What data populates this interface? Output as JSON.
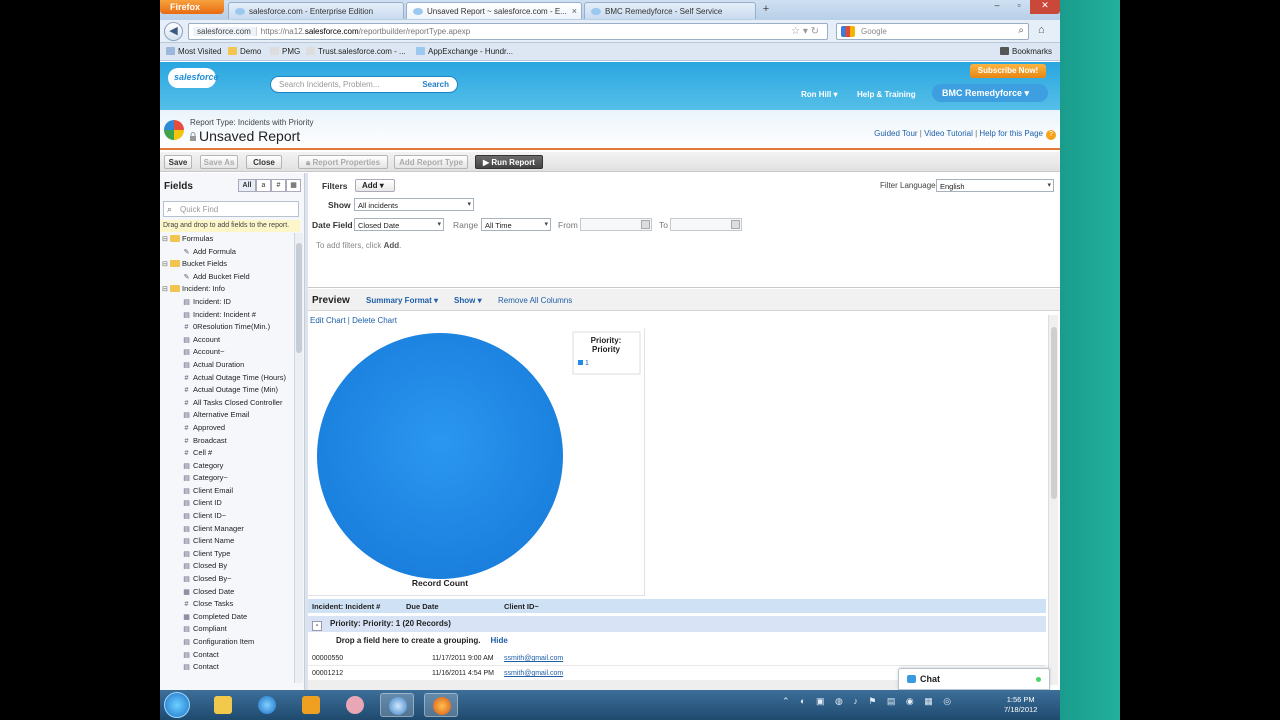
{
  "browser": {
    "menu_label": "Firefox",
    "tabs": [
      {
        "label": "salesforce.com - Enterprise Edition"
      },
      {
        "label": "Unsaved Report ~ salesforce.com - E..."
      },
      {
        "label": "BMC Remedyforce - Self Service"
      }
    ],
    "url_site": "salesforce.com",
    "url_prefix": "https://na12.",
    "url_host": "salesforce.com",
    "url_path": "/reportbuilder/reportType.apexp",
    "search_placeholder": "Google",
    "bookmarks": [
      "Most Visited",
      "Demo",
      "PMG",
      "Trust.salesforce.com - ...",
      "AppExchange - Hundr..."
    ],
    "bookmarks_menu": "Bookmarks"
  },
  "sf_header": {
    "logo": "salesforce",
    "search_placeholder": "Search Incidents, Problem...",
    "search_button": "Search",
    "subscribe_button": "Subscribe Now!",
    "user_menu": "Ron Hill",
    "help_menu": "Help & Training",
    "app_menu": "BMC Remedyforce"
  },
  "title_bar": {
    "report_type": "Report Type: Incidents with Priority",
    "title": "Unsaved Report",
    "help_links": [
      "Guided Tour",
      "Video Tutorial",
      "Help for this Page"
    ]
  },
  "toolbar": {
    "save": "Save",
    "save_as": "Save As",
    "close": "Close",
    "report_properties": "Report Properties",
    "add_report_type": "Add Report Type",
    "run_report": "Run Report"
  },
  "fields_panel": {
    "title": "Fields",
    "filter_all": "All",
    "quick_find_placeholder": "Quick Find",
    "drag_hint": "Drag and drop to add fields to the report.",
    "tree": [
      {
        "type": "folder",
        "label": "Formulas"
      },
      {
        "type": "add",
        "label": "Add Formula"
      },
      {
        "type": "folder",
        "label": "Bucket Fields"
      },
      {
        "type": "add",
        "label": "Add Bucket Field"
      },
      {
        "type": "folder",
        "label": "Incident: Info"
      },
      {
        "type": "text",
        "label": "Incident: ID"
      },
      {
        "type": "text",
        "label": "Incident: Incident #"
      },
      {
        "type": "num",
        "label": "0Resolution Time(Min.)"
      },
      {
        "type": "text",
        "label": "Account"
      },
      {
        "type": "text",
        "label": "Account~"
      },
      {
        "type": "text",
        "label": "Actual Duration"
      },
      {
        "type": "num",
        "label": "Actual Outage Time (Hours)"
      },
      {
        "type": "num",
        "label": "Actual Outage Time (Min)"
      },
      {
        "type": "num",
        "label": "All Tasks Closed Controller"
      },
      {
        "type": "text",
        "label": "Alternative Email"
      },
      {
        "type": "num",
        "label": "Approved"
      },
      {
        "type": "num",
        "label": "Broadcast"
      },
      {
        "type": "num",
        "label": "Cell #"
      },
      {
        "type": "text",
        "label": "Category"
      },
      {
        "type": "text",
        "label": "Category~"
      },
      {
        "type": "text",
        "label": "Client Email"
      },
      {
        "type": "text",
        "label": "Client ID"
      },
      {
        "type": "text",
        "label": "Client ID~"
      },
      {
        "type": "text",
        "label": "Client Manager"
      },
      {
        "type": "text",
        "label": "Client Name"
      },
      {
        "type": "text",
        "label": "Client Type"
      },
      {
        "type": "text",
        "label": "Closed By"
      },
      {
        "type": "text",
        "label": "Closed By~"
      },
      {
        "type": "date",
        "label": "Closed Date"
      },
      {
        "type": "num",
        "label": "Close Tasks"
      },
      {
        "type": "date",
        "label": "Completed Date"
      },
      {
        "type": "text",
        "label": "Compliant"
      },
      {
        "type": "text",
        "label": "Configuration Item"
      },
      {
        "type": "text",
        "label": "Contact"
      },
      {
        "type": "text",
        "label": "Contact"
      }
    ]
  },
  "filters": {
    "label": "Filters",
    "add_button": "Add",
    "show_label": "Show",
    "show_value": "All incidents",
    "date_field_label": "Date Field",
    "date_field_value": "Closed Date",
    "range_label": "Range",
    "range_value": "All Time",
    "from_label": "From",
    "to_label": "To",
    "hint_prefix": "To add filters, click ",
    "hint_action": "Add",
    "hint_suffix": ".",
    "filter_language_label": "Filter Language",
    "filter_language_value": "English"
  },
  "preview": {
    "title": "Preview",
    "format": "Summary Format",
    "show": "Show",
    "remove_all": "Remove All Columns",
    "edit_chart": "Edit Chart",
    "delete_chart": "Delete Chart",
    "columns": [
      "Incident: Incident #",
      "Due Date",
      "Client ID~"
    ],
    "group_label": "Priority: Priority: 1 (20 Records)",
    "group_toggle": "-",
    "drop_hint": "Drop a field here to create a grouping.",
    "hide_link": "Hide",
    "rows": [
      {
        "id": "00000550",
        "date": "11/17/2011 9:00 AM",
        "email": "ssmith@gmail.com"
      },
      {
        "id": "00001212",
        "date": "11/16/2011 4:54 PM",
        "email": "ssmith@gmail.com"
      }
    ]
  },
  "chart_data": {
    "type": "pie",
    "categories": [
      "1"
    ],
    "values": [
      20
    ],
    "title": "",
    "xlabel": "Record Count",
    "legend_title": "Priority: Priority",
    "legend_position": "top-right",
    "color": "#1f8be8"
  },
  "chat": {
    "label": "Chat"
  },
  "taskbar": {
    "time": "1:56 PM",
    "date": "7/18/2012"
  },
  "colors": {
    "sf_blue": "#2aa6e0",
    "accent_orange": "#e07a3a",
    "link": "#1f5fa8"
  }
}
